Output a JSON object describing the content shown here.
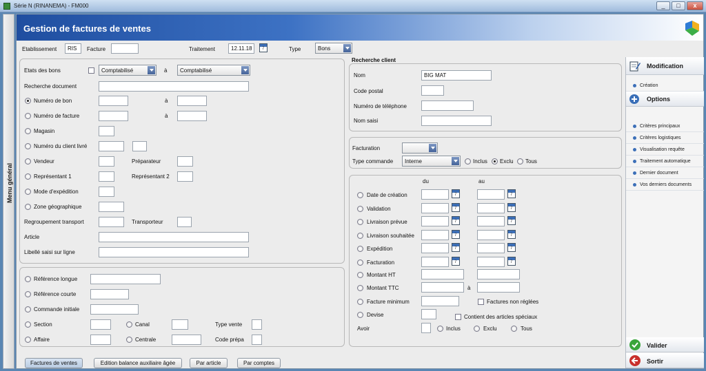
{
  "window": {
    "title": "Série N (RINANEMA) - FM000",
    "min": "_",
    "max": "□",
    "close": "x"
  },
  "side_menu": {
    "label": "Menu général"
  },
  "header": {
    "title": "Gestion de factures de ventes"
  },
  "top": {
    "etablissement_label": "Etablissement",
    "etablissement_value": "RIS",
    "facture_label": "Facture",
    "facture_value": "",
    "traitement_label": "Traitement",
    "traitement_value": "12.11.18",
    "type_label": "Type",
    "type_value": "Bons"
  },
  "left1": {
    "etats_label": "Etats des bons",
    "etats_from": "Comptabilisé",
    "a": "à",
    "etats_to": "Comptabilisé",
    "recherche_doc": "Recherche document",
    "numero_bon": "Numéro de bon",
    "numero_facture": "Numéro de facture",
    "magasin": "Magasin",
    "client_livre": "Numéro du client livré",
    "vendeur": "Vendeur",
    "preparateur": "Préparateur",
    "representant1": "Représentant 1",
    "representant2": "Représentant 2",
    "mode_expedition": "Mode d'expédition",
    "zone_geo": "Zone géographique",
    "regroupement": "Regroupement transport",
    "transporteur": "Transporteur",
    "article": "Article",
    "libelle": "Libellé saisi sur ligne"
  },
  "left2": {
    "ref_longue": "Référence longue",
    "ref_courte": "Référence courte",
    "commande_initiale": "Commande initiale",
    "section": "Section",
    "canal": "Canal",
    "type_vente": "Type vente",
    "affaire": "Affaire",
    "centrale": "Centrale",
    "code_prepa": "Code prépa"
  },
  "client": {
    "title": "Recherche client",
    "nom_label": "Nom",
    "nom_value": "BIG MAT",
    "cp_label": "Code postal",
    "tel_label": "Numéro de téléphone",
    "nom_saisi_label": "Nom saisi"
  },
  "facturation": {
    "facturation_label": "Facturation",
    "facturation_value": "",
    "type_cmd_label": "Type commande",
    "type_cmd_value": "Interne",
    "inclus": "Inclus",
    "exclu": "Exclu",
    "tous": "Tous"
  },
  "dates": {
    "du": "du",
    "au": "au",
    "a": "à",
    "rows": [
      "Date de création",
      "Validation",
      "Livraison prévue",
      "Livraison souhaitée",
      "Expédition",
      "Facturation"
    ],
    "montant_ht": "Montant HT",
    "montant_ttc": "Montant TTC",
    "facture_min": "Facture minimum",
    "factures_non_reglees": "Factures non réglées",
    "devise": "Devise",
    "articles_speciaux": "Contient des articles spéciaux",
    "avoir": "Avoir",
    "inclus": "Inclus",
    "exclu": "Exclu",
    "tous": "Tous"
  },
  "nav": {
    "modification": "Modification",
    "creation": "Création",
    "options": "Options",
    "items": [
      "Critères principaux",
      "Critères logistiques",
      "Visualisation requête",
      "Traitement automatique",
      "Dernier document",
      "Vos derniers documents"
    ],
    "valider": "Valider",
    "sortir": "Sortir"
  },
  "tabs": [
    "Factures de ventes",
    "Edition balance auxiliaire âgée",
    "Par article",
    "Par comptes"
  ],
  "colors": {
    "header_blue": "#1f4ea0",
    "accent": "#3c6fb8",
    "valider_green": "#3aa53a",
    "sortir_red": "#c9302c"
  }
}
